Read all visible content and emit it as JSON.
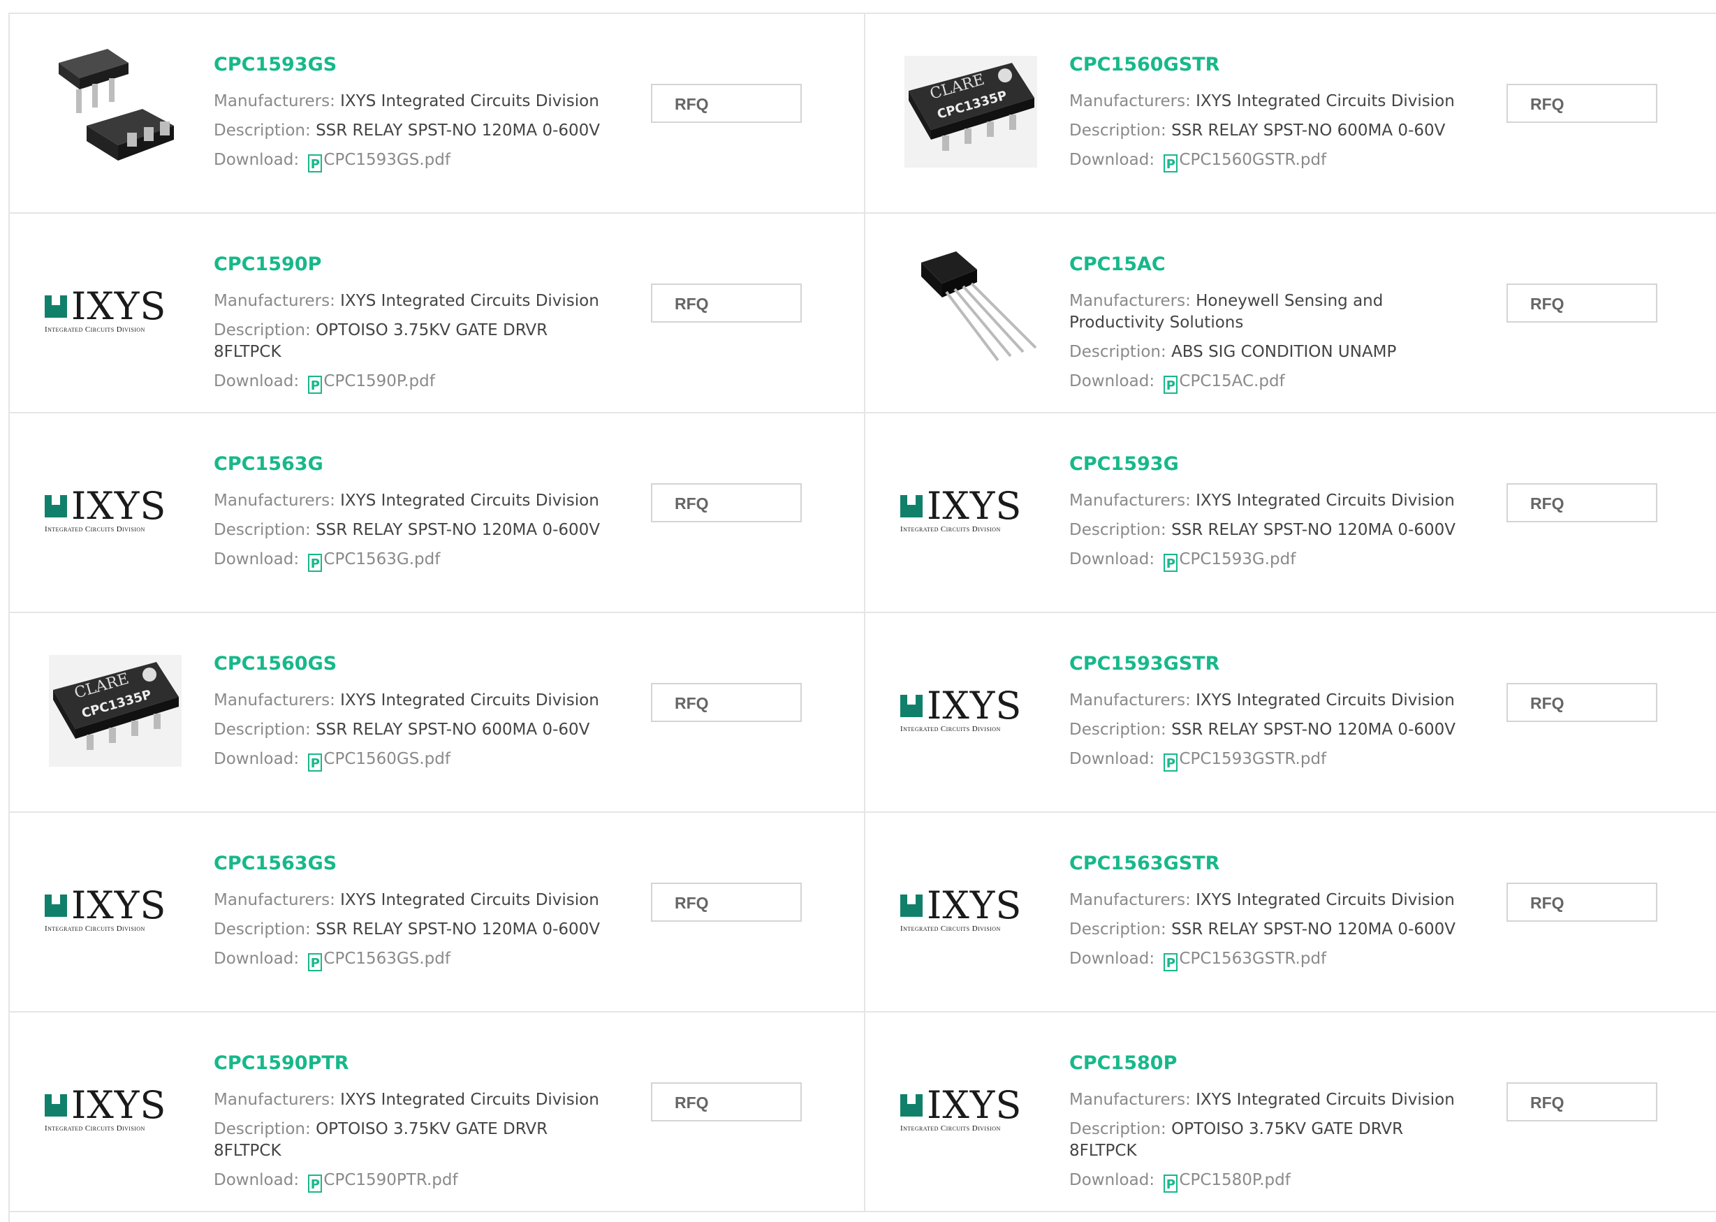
{
  "labels": {
    "manufacturers": "Manufacturers:",
    "description": "Description:",
    "download": "Download:",
    "rfq": "RFQ"
  },
  "logo": {
    "word": "IXYS",
    "sub": "Integrated Circuits Division",
    "clare_brand": "CLARE",
    "clare_part": "CPC1335P"
  },
  "colors": {
    "accent": "#17b88a",
    "ixys_green": "#11806a",
    "border": "#e5e5e5"
  },
  "products": [
    {
      "pn": "CPC1593GS",
      "manufacturer": "IXYS Integrated Circuits Division",
      "description": "SSR RELAY SPST-NO 120MA 0-600V",
      "file": "CPC1593GS.pdf",
      "image": "chip-6pin"
    },
    {
      "pn": "CPC1560GSTR",
      "manufacturer": "IXYS Integrated Circuits Division",
      "description": "SSR RELAY SPST-NO 600MA 0-60V",
      "file": "CPC1560GSTR.pdf",
      "image": "clare-chip"
    },
    {
      "pn": "CPC1590P",
      "manufacturer": "IXYS Integrated Circuits Division",
      "description": "OPTOISO 3.75KV GATE DRVR 8FLTPCK",
      "file": "CPC1590P.pdf",
      "image": "ixys-logo"
    },
    {
      "pn": "CPC15AC",
      "manufacturer": "Honeywell Sensing and Productivity Solutions",
      "description": "ABS SIG CONDITION UNAMP",
      "file": "CPC15AC.pdf",
      "image": "sensor"
    },
    {
      "pn": "CPC1563G",
      "manufacturer": "IXYS Integrated Circuits Division",
      "description": "SSR RELAY SPST-NO 120MA 0-600V",
      "file": "CPC1563G.pdf",
      "image": "ixys-logo"
    },
    {
      "pn": "CPC1593G",
      "manufacturer": "IXYS Integrated Circuits Division",
      "description": "SSR RELAY SPST-NO 120MA 0-600V",
      "file": "CPC1593G.pdf",
      "image": "ixys-logo"
    },
    {
      "pn": "CPC1560GS",
      "manufacturer": "IXYS Integrated Circuits Division",
      "description": "SSR RELAY SPST-NO 600MA 0-60V",
      "file": "CPC1560GS.pdf",
      "image": "clare-chip"
    },
    {
      "pn": "CPC1593GSTR",
      "manufacturer": "IXYS Integrated Circuits Division",
      "description": "SSR RELAY SPST-NO 120MA 0-600V",
      "file": "CPC1593GSTR.pdf",
      "image": "ixys-logo"
    },
    {
      "pn": "CPC1563GS",
      "manufacturer": "IXYS Integrated Circuits Division",
      "description": "SSR RELAY SPST-NO 120MA 0-600V",
      "file": "CPC1563GS.pdf",
      "image": "ixys-logo"
    },
    {
      "pn": "CPC1563GSTR",
      "manufacturer": "IXYS Integrated Circuits Division",
      "description": "SSR RELAY SPST-NO 120MA 0-600V",
      "file": "CPC1563GSTR.pdf",
      "image": "ixys-logo"
    },
    {
      "pn": "CPC1590PTR",
      "manufacturer": "IXYS Integrated Circuits Division",
      "description": "OPTOISO 3.75KV GATE DRVR 8FLTPCK",
      "file": "CPC1590PTR.pdf",
      "image": "ixys-logo"
    },
    {
      "pn": "CPC1580P",
      "manufacturer": "IXYS Integrated Circuits Division",
      "description": "OPTOISO 3.75KV GATE DRVR 8FLTPCK",
      "file": "CPC1580P.pdf",
      "image": "ixys-logo"
    }
  ]
}
